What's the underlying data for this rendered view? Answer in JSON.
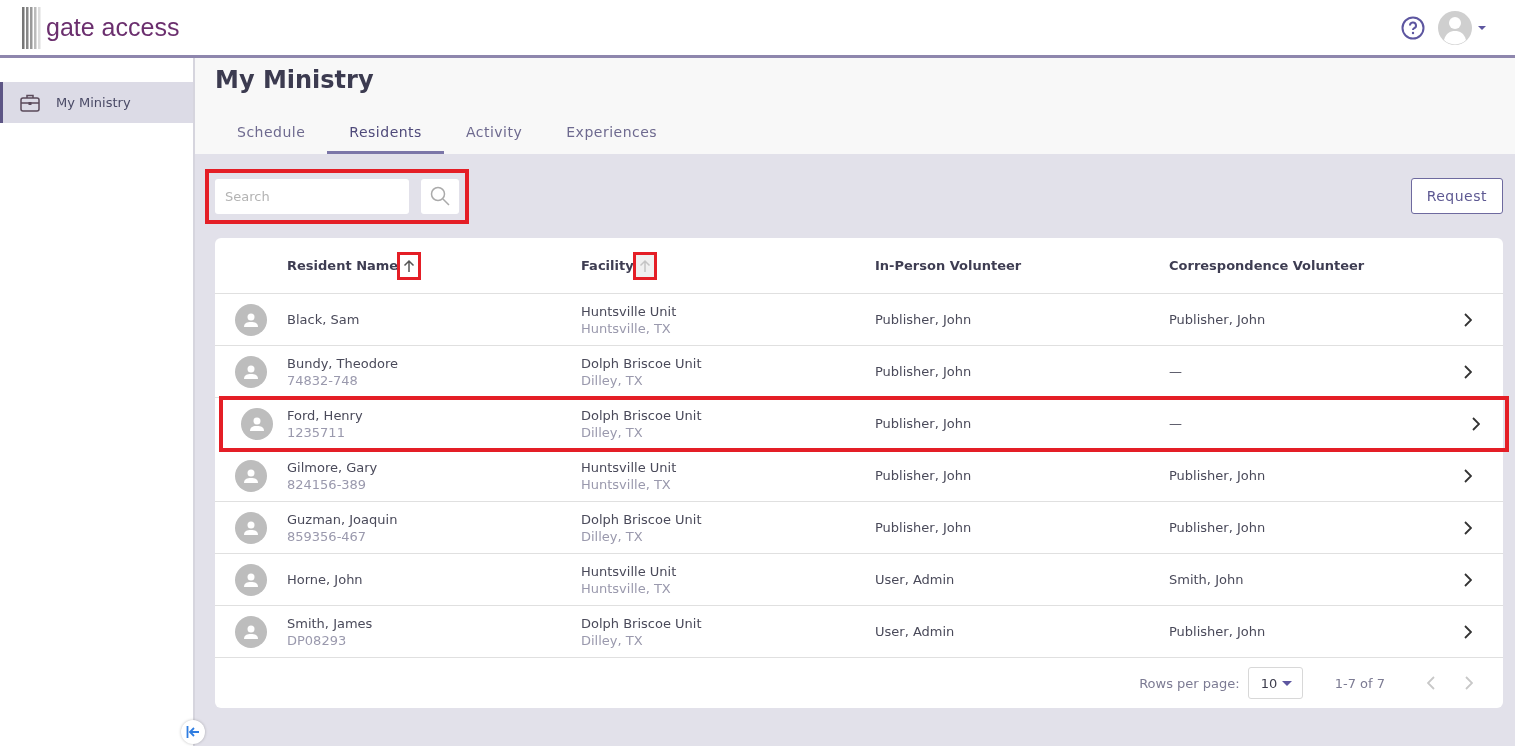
{
  "logo": {
    "text": "gate access"
  },
  "sidebar": {
    "items": [
      {
        "label": "My Ministry",
        "selected": true
      }
    ]
  },
  "page_title": "My Ministry",
  "tabs": [
    {
      "label": "Schedule",
      "selected": false
    },
    {
      "label": "Residents",
      "selected": true
    },
    {
      "label": "Activity",
      "selected": false
    },
    {
      "label": "Experiences",
      "selected": false
    }
  ],
  "search": {
    "placeholder": "Search",
    "highlighted": true
  },
  "request_button": "Request",
  "table": {
    "columns": [
      {
        "label": "Resident Name",
        "sorted": true,
        "highlighted": true
      },
      {
        "label": "Facility",
        "sorted": false,
        "highlighted": true
      },
      {
        "label": "In-Person Volunteer"
      },
      {
        "label": "Correspondence Volunteer"
      }
    ],
    "rows": [
      {
        "name": "Black, Sam",
        "facility": "Huntsville Unit",
        "location": "Huntsville, TX",
        "in_person": "Publisher, John",
        "correspondence": "Publisher, John",
        "highlighted": false
      },
      {
        "name": "Bundy, Theodore",
        "id": "74832-748",
        "facility": "Dolph Briscoe Unit",
        "location": "Dilley, TX",
        "in_person": "Publisher, John",
        "correspondence": "—",
        "highlighted": false
      },
      {
        "name": "Ford, Henry",
        "id": "1235711",
        "facility": "Dolph Briscoe Unit",
        "location": "Dilley, TX",
        "in_person": "Publisher, John",
        "correspondence": "—",
        "highlighted": true
      },
      {
        "name": "Gilmore, Gary",
        "id": "824156-389",
        "facility": "Huntsville Unit",
        "location": "Huntsville, TX",
        "in_person": "Publisher, John",
        "correspondence": "Publisher, John",
        "highlighted": false
      },
      {
        "name": "Guzman, Joaquin",
        "id": "859356-467",
        "facility": "Dolph Briscoe Unit",
        "location": "Dilley, TX",
        "in_person": "Publisher, John",
        "correspondence": "Publisher, John",
        "highlighted": false
      },
      {
        "name": "Horne, John",
        "facility": "Huntsville Unit",
        "location": "Huntsville, TX",
        "in_person": "User, Admin",
        "correspondence": "Smith, John",
        "highlighted": false
      },
      {
        "name": "Smith, James",
        "id": "DP08293",
        "facility": "Dolph Briscoe Unit",
        "location": "Dilley, TX",
        "in_person": "User, Admin",
        "correspondence": "Publisher, John",
        "highlighted": false
      }
    ]
  },
  "pagination": {
    "rows_per_page_label": "Rows per page:",
    "rows_per_page": "10",
    "range": "1-7 of 7",
    "prev_disabled": true,
    "next_disabled": true
  }
}
